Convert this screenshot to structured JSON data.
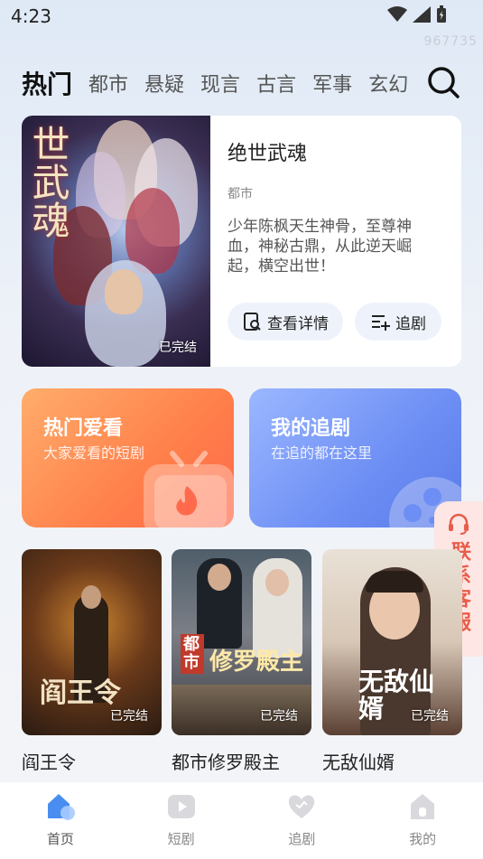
{
  "status": {
    "time": "4:23",
    "watermark": "967735"
  },
  "tabs": [
    {
      "label": "热门",
      "active": true
    },
    {
      "label": "都市"
    },
    {
      "label": "悬疑"
    },
    {
      "label": "现言"
    },
    {
      "label": "古言"
    },
    {
      "label": "军事"
    },
    {
      "label": "玄幻"
    }
  ],
  "featured": {
    "poster_text": "世武魂",
    "title": "绝世武魂",
    "genre": "都市",
    "description": "少年陈枫天生神骨，至尊神血，神秘古鼎，从此逆天崛起，横空出世！",
    "status_badge": "已完结",
    "details_button": "查看详情",
    "follow_button": "追剧"
  },
  "cards": {
    "hot": {
      "title": "热门爱看",
      "subtitle": "大家爱看的短剧"
    },
    "mine": {
      "title": "我的追剧",
      "subtitle": "在追的都在这里"
    }
  },
  "contact": {
    "label": "联系客服"
  },
  "dramas": [
    {
      "name": "阎王令",
      "poster_text": "阎王令",
      "badge": "已完结"
    },
    {
      "name": "都市修罗殿主",
      "poster_text": "修罗殿主",
      "poster_tag": "都市",
      "badge": "已完结"
    },
    {
      "name": "无敌仙婿",
      "poster_text": "无敌仙婿",
      "badge": "已完结"
    }
  ],
  "nav": [
    {
      "label": "首页",
      "icon": "home-icon",
      "active": true
    },
    {
      "label": "短剧",
      "icon": "play-icon"
    },
    {
      "label": "追剧",
      "icon": "heart-icon"
    },
    {
      "label": "我的",
      "icon": "user-icon"
    }
  ],
  "colors": {
    "hot_card": "#ff7f4a",
    "mine_card": "#6d8ef4",
    "contact_text": "#e85c4a",
    "nav_active": "#4a8df0"
  }
}
